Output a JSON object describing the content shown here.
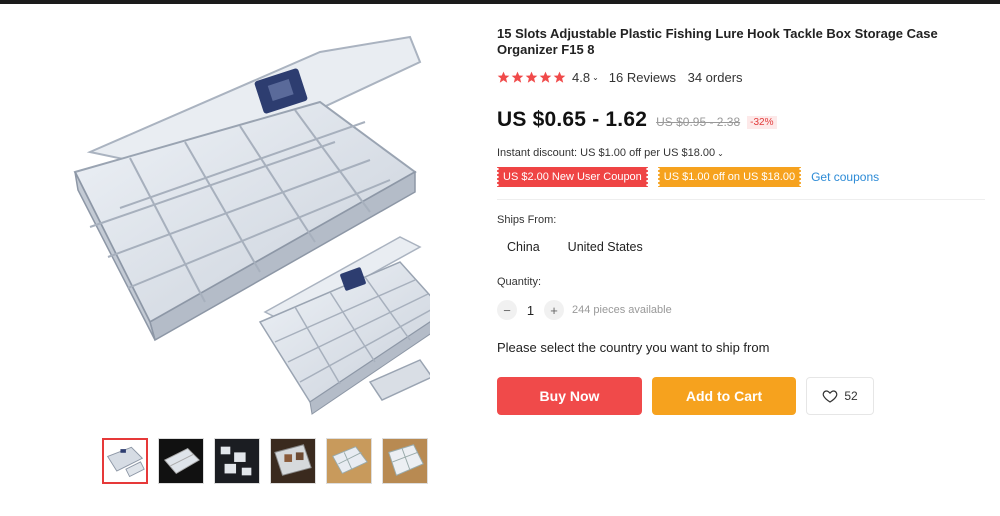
{
  "product": {
    "title": "15 Slots Adjustable Plastic Fishing Lure Hook Tackle Box Storage Case Organizer F15 8",
    "rating": "4.8",
    "stars": 5,
    "reviews": "16 Reviews",
    "orders": "34 orders",
    "price": "US $0.65 - 1.62",
    "old_price": "US $0.95 - 2.38",
    "discount": "-32%"
  },
  "promotions": {
    "instant_discount": "Instant discount: US $1.00 off per US $18.00",
    "coupons": [
      "US $2.00 New User Coupon",
      "US $1.00 off on US $18.00"
    ],
    "get_coupons": "Get coupons"
  },
  "shipping": {
    "label": "Ships From:",
    "options": [
      "China",
      "United States"
    ]
  },
  "quantity": {
    "label": "Quantity:",
    "value": "1",
    "minus": "−",
    "plus": "+",
    "available": "244 pieces available"
  },
  "ship_message": "Please select the country you want to ship from",
  "actions": {
    "buy_now": "Buy Now",
    "add_to_cart": "Add to Cart",
    "wishlist_count": "52"
  },
  "colors": {
    "star": "#f04a4a",
    "buy_now": "#f04a4a",
    "add_to_cart": "#f6a21e",
    "link": "#2d8bd6"
  },
  "gallery": {
    "thumbnail_count": 6,
    "active_index": 0
  }
}
